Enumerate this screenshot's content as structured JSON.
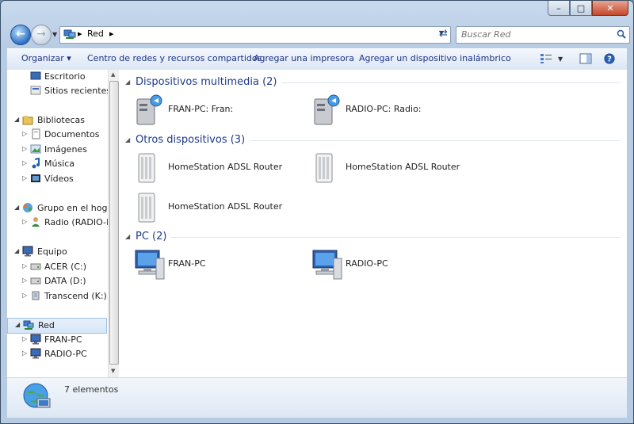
{
  "window": {
    "caption_buttons": {
      "minimize": "–",
      "maximize": "□",
      "close": "✕"
    }
  },
  "navbar": {
    "back_icon": "back-arrow-icon",
    "forward_icon": "forward-arrow-icon",
    "address": {
      "crumbs": [
        "Red"
      ],
      "separator": "▸"
    },
    "search_placeholder": "Buscar Red"
  },
  "toolbar": {
    "organize": "Organizar ▾",
    "network_center": "Centro de redes y recursos compartidos",
    "add_printer": "Agregar una impresora",
    "add_wireless": "Agregar un dispositivo inalámbrico"
  },
  "nav": {
    "items": [
      {
        "label": "Escritorio",
        "icon": "desktop-icon",
        "indent": 1
      },
      {
        "label": "Sitios recientes",
        "icon": "recent-places-icon",
        "indent": 1
      },
      {
        "label": "Bibliotecas",
        "icon": "libraries-icon",
        "indent": 0,
        "expanded": true
      },
      {
        "label": "Documentos",
        "icon": "documents-icon",
        "indent": 1,
        "collapsed": true
      },
      {
        "label": "Imágenes",
        "icon": "pictures-icon",
        "indent": 1,
        "collapsed": true
      },
      {
        "label": "Música",
        "icon": "music-icon",
        "indent": 1,
        "collapsed": true
      },
      {
        "label": "Vídeos",
        "icon": "videos-icon",
        "indent": 1,
        "collapsed": true
      },
      {
        "label": "Grupo en el hogar",
        "icon": "homegroup-icon",
        "indent": 0,
        "expanded": true
      },
      {
        "label": "Radio (RADIO-PC)",
        "icon": "user-icon",
        "indent": 1,
        "collapsed": true
      },
      {
        "label": "Equipo",
        "icon": "computer-icon",
        "indent": 0,
        "expanded": true
      },
      {
        "label": "ACER (C:)",
        "icon": "drive-icon",
        "indent": 1,
        "collapsed": true
      },
      {
        "label": "DATA (D:)",
        "icon": "drive-icon",
        "indent": 1,
        "collapsed": true
      },
      {
        "label": "Transcend (K:)",
        "icon": "usb-drive-icon",
        "indent": 1,
        "collapsed": true
      },
      {
        "label": "Red",
        "icon": "network-icon",
        "indent": 0,
        "expanded": true,
        "selected": true
      },
      {
        "label": "FRAN-PC",
        "icon": "computer-icon",
        "indent": 1,
        "collapsed": true
      },
      {
        "label": "RADIO-PC",
        "icon": "computer-icon",
        "indent": 1,
        "collapsed": true
      }
    ]
  },
  "groups": [
    {
      "label": "Dispositivos multimedia (2)",
      "items": [
        {
          "label": "FRAN-PC: Fran:",
          "icon": "media-device-icon"
        },
        {
          "label": "RADIO-PC: Radio:",
          "icon": "media-device-icon"
        }
      ]
    },
    {
      "label": "Otros dispositivos (3)",
      "items": [
        {
          "label": "HomeStation ADSL Router",
          "icon": "router-icon"
        },
        {
          "label": "HomeStation ADSL Router",
          "icon": "router-icon"
        },
        {
          "label": "HomeStation ADSL Router",
          "icon": "router-icon"
        }
      ]
    },
    {
      "label": "PC (2)",
      "items": [
        {
          "label": "FRAN-PC",
          "icon": "network-computer-icon"
        },
        {
          "label": "RADIO-PC",
          "icon": "network-computer-icon"
        }
      ]
    }
  ],
  "details": {
    "count": "7 elementos",
    "icon": "network-globe-icon"
  },
  "colors": {
    "accent": "#1e3b8a",
    "selection": "#d5e6f8"
  }
}
